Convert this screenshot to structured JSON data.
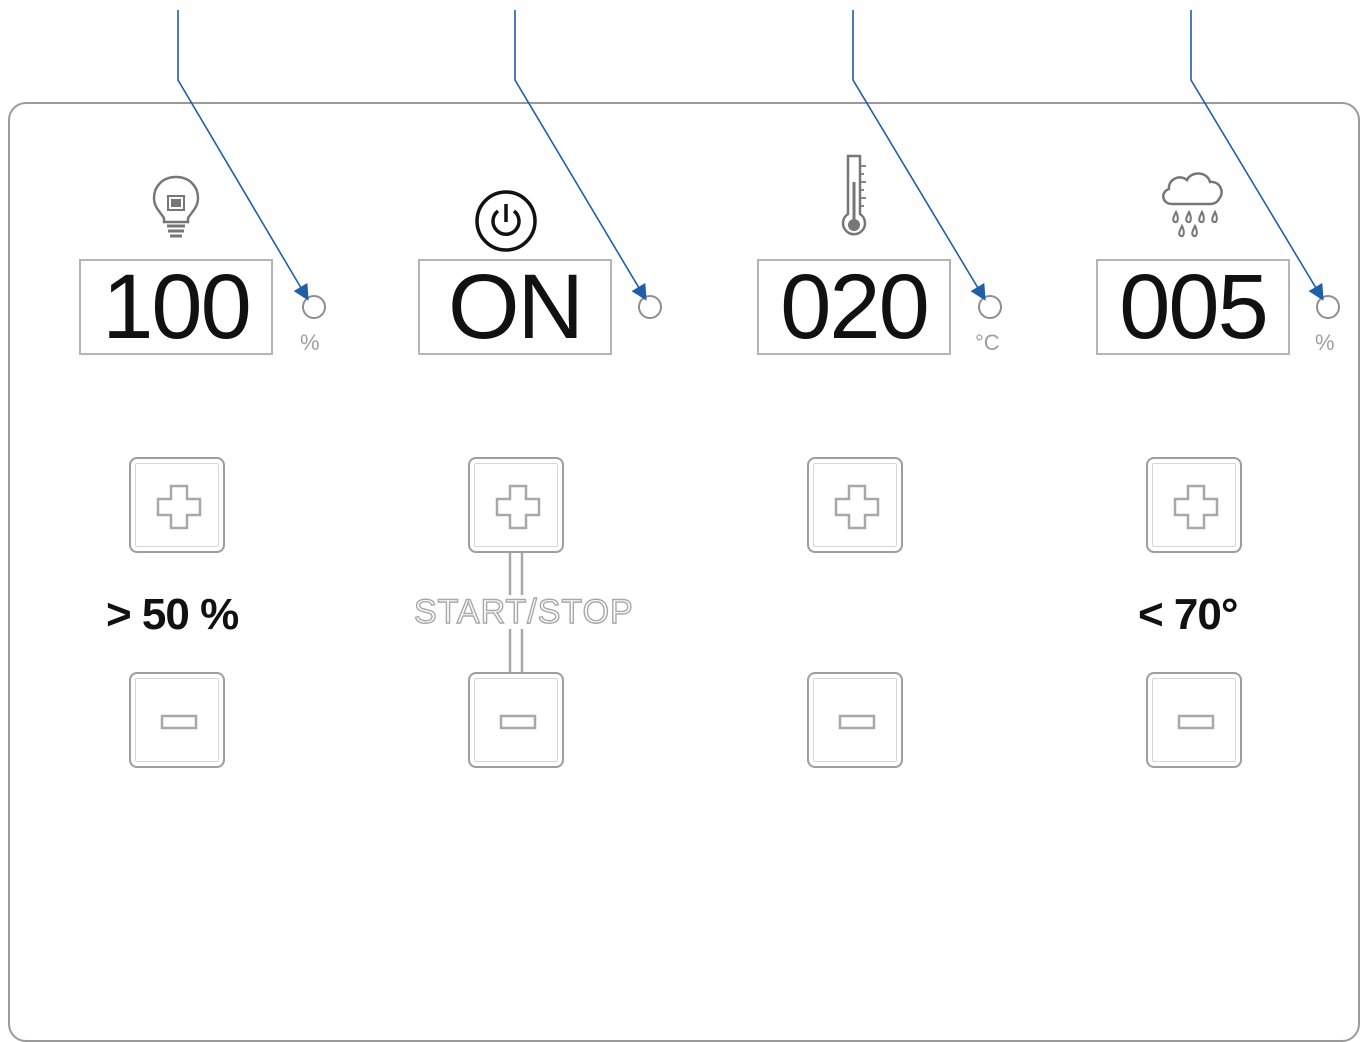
{
  "channels": [
    {
      "icon": "light-bulb-icon",
      "display_value": "100",
      "unit": "%",
      "note": "> 50 %"
    },
    {
      "icon": "power-icon",
      "display_value": "ON",
      "unit": "",
      "key_label": "START/STOP"
    },
    {
      "icon": "thermometer-icon",
      "display_value": "020",
      "unit": "°C"
    },
    {
      "icon": "rain-cloud-icon",
      "display_value": "005",
      "unit": "%",
      "note": "< 70°"
    }
  ],
  "colors": {
    "leader_line": "#1f5fa8",
    "outline": "#9a9a9a",
    "text": "#111111"
  }
}
